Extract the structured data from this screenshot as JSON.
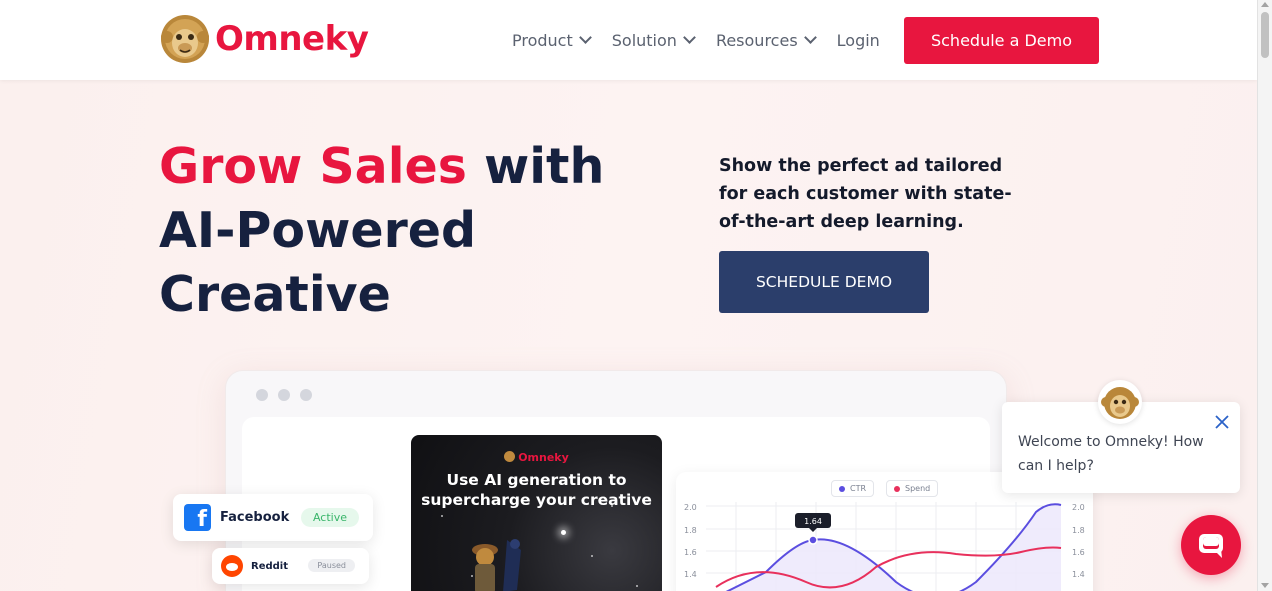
{
  "header": {
    "brand": "Omneky",
    "nav": [
      {
        "label": "Product",
        "has_dropdown": true
      },
      {
        "label": "Solution",
        "has_dropdown": true
      },
      {
        "label": "Resources",
        "has_dropdown": true
      }
    ],
    "login_label": "Login",
    "cta_label": "Schedule a Demo"
  },
  "hero": {
    "title_accent": "Grow Sales",
    "title_rest_1": " with",
    "title_line_2": "AI-Powered",
    "title_line_3": "Creative",
    "subtitle": "Show the perfect ad tailored for each customer with state-of-the-art deep learning.",
    "cta_label": "SCHEDULE DEMO"
  },
  "mockup": {
    "platforms": [
      {
        "name": "Facebook",
        "status": "Active"
      },
      {
        "name": "Reddit",
        "status": "Paused"
      }
    ],
    "ad": {
      "brand": "Omneky",
      "headline_1": "Use AI generation to",
      "headline_2": "supercharge your creative"
    },
    "chart": {
      "legend": [
        {
          "name": "CTR",
          "color": "#5b4ee0"
        },
        {
          "name": "Spend",
          "color": "#e8305c"
        }
      ],
      "tooltip": "1.64",
      "left_ticks": [
        "2.0",
        "1.8",
        "1.6",
        "1.4"
      ],
      "right_ticks": [
        "2.0",
        "1.8",
        "1.6",
        "1.4"
      ]
    }
  },
  "chat": {
    "message": "Welcome to Omneky! How can I help?"
  },
  "colors": {
    "brand_red": "#e8163f",
    "navy": "#2b3e6b",
    "heading": "#16213f"
  },
  "icons": [
    "chevron-down-icon",
    "close-icon",
    "chat-icon",
    "facebook-icon",
    "reddit-icon",
    "monkey-logo-icon"
  ]
}
